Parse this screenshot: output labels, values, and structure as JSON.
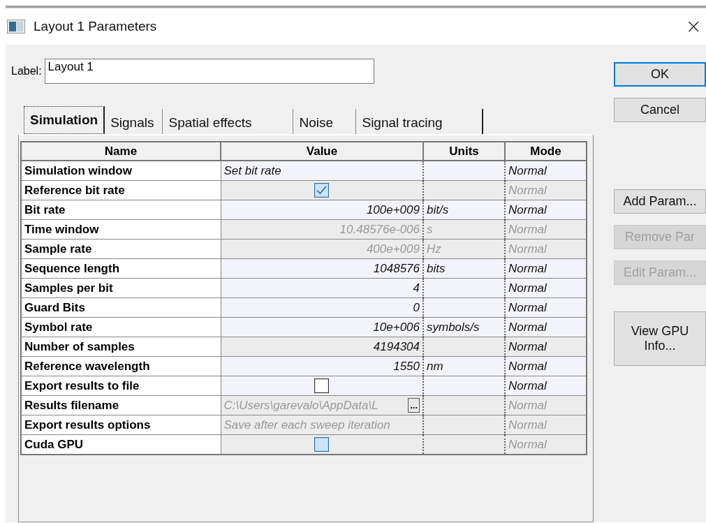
{
  "window": {
    "title": "Layout 1 Parameters",
    "close": "×"
  },
  "label_field": {
    "label": "Label:",
    "value": "Layout 1"
  },
  "tabs": [
    {
      "label": "Simulation",
      "selected": true
    },
    {
      "label": "Signals",
      "selected": false
    },
    {
      "label": "Spatial effects",
      "selected": false
    },
    {
      "label": "Noise",
      "selected": false
    },
    {
      "label": "Signal tracing",
      "selected": false
    }
  ],
  "table": {
    "columns": [
      "Name",
      "Value",
      "Units",
      "Mode"
    ],
    "rows": [
      {
        "name": "Simulation window",
        "kind": "text",
        "value": "Set bit rate",
        "units": "",
        "mode": "Normal",
        "editable": true,
        "disabled": false
      },
      {
        "name": "Reference bit rate",
        "kind": "checkbox",
        "checked": true,
        "units": "",
        "mode": "Normal",
        "editable": false,
        "disabled": true
      },
      {
        "name": "Bit rate",
        "kind": "number",
        "value": "100e+009",
        "units": "bit/s",
        "mode": "Normal",
        "editable": true,
        "disabled": false
      },
      {
        "name": "Time window",
        "kind": "number",
        "value": "10.48576e-006",
        "units": "s",
        "mode": "Normal",
        "editable": false,
        "disabled": true
      },
      {
        "name": "Sample rate",
        "kind": "number",
        "value": "400e+009",
        "units": "Hz",
        "mode": "Normal",
        "editable": false,
        "disabled": true
      },
      {
        "name": "Sequence length",
        "kind": "number",
        "value": "1048576",
        "units": "bits",
        "mode": "Normal",
        "editable": true,
        "disabled": false
      },
      {
        "name": "Samples per bit",
        "kind": "number",
        "value": "4",
        "units": "",
        "mode": "Normal",
        "editable": true,
        "disabled": false
      },
      {
        "name": "Guard Bits",
        "kind": "number",
        "value": "0",
        "units": "",
        "mode": "Normal",
        "editable": true,
        "disabled": false
      },
      {
        "name": "Symbol rate",
        "kind": "number",
        "value": "10e+006",
        "units": "symbols/s",
        "mode": "Normal",
        "editable": true,
        "disabled": false
      },
      {
        "name": "Number of samples",
        "kind": "number",
        "value": "4194304",
        "units": "",
        "mode": "Normal",
        "editable": false,
        "disabled": false
      },
      {
        "name": "Reference wavelength",
        "kind": "number",
        "value": "1550",
        "units": "nm",
        "mode": "Normal",
        "editable": true,
        "disabled": false
      },
      {
        "name": "Export results to file",
        "kind": "checkbox",
        "checked": false,
        "units": "",
        "mode": "Normal",
        "editable": true,
        "disabled": false
      },
      {
        "name": "Results filename",
        "kind": "file",
        "value": "C:\\Users\\garevalo\\AppData\\L",
        "browse": "...",
        "units": "",
        "mode": "Normal",
        "editable": false,
        "disabled": true
      },
      {
        "name": "Export results options",
        "kind": "text",
        "value": "Save after each sweep iteration",
        "units": "",
        "mode": "Normal",
        "editable": false,
        "disabled": true
      },
      {
        "name": "Cuda GPU",
        "kind": "checkbox",
        "checked": false,
        "units": "",
        "mode": "Normal",
        "editable": false,
        "disabled": true
      }
    ]
  },
  "buttons": [
    {
      "label": "OK",
      "default": true,
      "disabled": false
    },
    {
      "label": "Cancel",
      "default": false,
      "disabled": false
    },
    {
      "label": "Add Param...",
      "default": false,
      "disabled": false
    },
    {
      "label": "Remove Par",
      "default": false,
      "disabled": true
    },
    {
      "label": "Edit Param...",
      "default": false,
      "disabled": true
    },
    {
      "label": "View GPU Info...",
      "default": false,
      "disabled": false
    }
  ]
}
